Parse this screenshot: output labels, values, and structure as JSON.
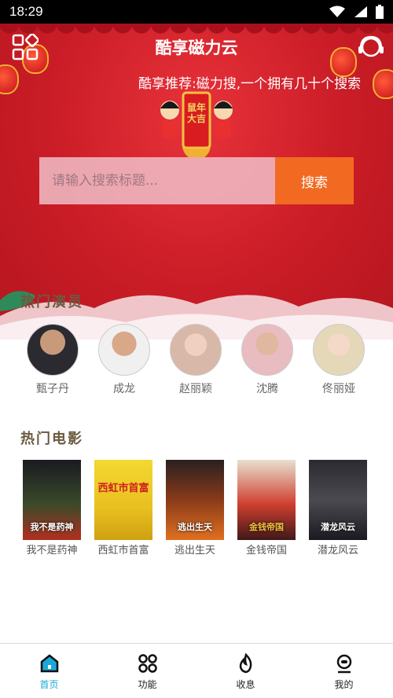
{
  "status_bar": {
    "time": "18:29"
  },
  "header": {
    "title": "酷享磁力云",
    "marquee": "酷享推荐:磁力搜,一个拥有几十个搜索",
    "banner_text": "鼠年大吉"
  },
  "search": {
    "placeholder": "请输入搜索标题...",
    "button_label": "搜索"
  },
  "hot_actors": {
    "title": "热门演员",
    "items": [
      {
        "name": "甄子丹"
      },
      {
        "name": "成龙"
      },
      {
        "name": "赵丽颖"
      },
      {
        "name": "沈腾"
      },
      {
        "name": "佟丽娅"
      }
    ]
  },
  "hot_movies": {
    "title": "热门电影",
    "items": [
      {
        "name": "我不是药神",
        "poster_text": "我不是药神",
        "color": "#3a4a2a"
      },
      {
        "name": "西虹市首富",
        "poster_text": "西虹市首富",
        "color": "#e8c020"
      },
      {
        "name": "逃出生天",
        "poster_text": "逃出生天",
        "color": "#8a3a1a"
      },
      {
        "name": "金钱帝国",
        "poster_text": "金钱帝国",
        "color": "#b02020"
      },
      {
        "name": "潜龙风云",
        "poster_text": "潜龙风云",
        "color": "#2a2a30"
      }
    ]
  },
  "tabbar": {
    "items": [
      {
        "label": "首页",
        "active": true
      },
      {
        "label": "功能",
        "active": false
      },
      {
        "label": "收息",
        "active": false
      },
      {
        "label": "我的",
        "active": false
      }
    ]
  },
  "colors": {
    "accent": "#f26a22",
    "hero_red": "#c91c26",
    "tab_active": "#1aa8d8"
  }
}
